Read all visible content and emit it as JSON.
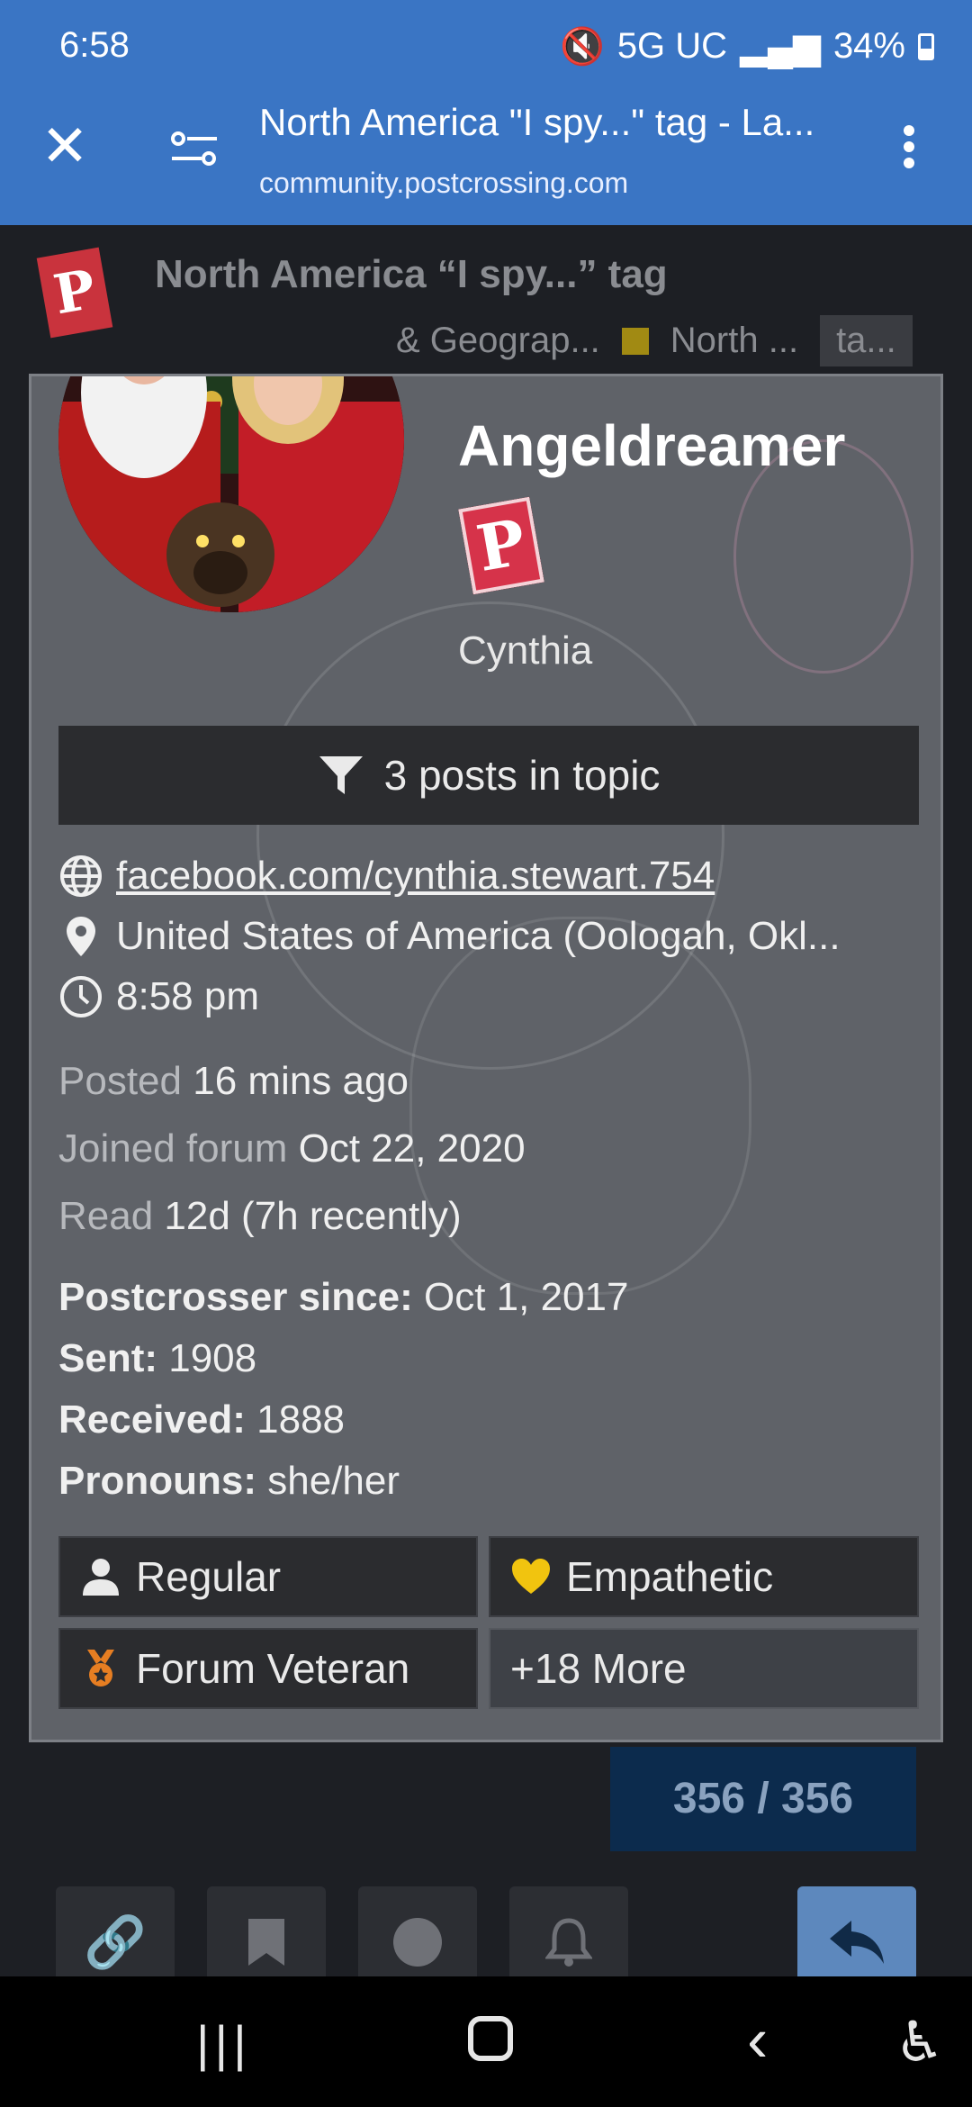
{
  "status_bar": {
    "time": "6:58",
    "network": "5G UC",
    "battery": "34%"
  },
  "browser": {
    "page_title": "North America \"I spy...\" tag - La...",
    "host": "community.postcrossing.com"
  },
  "topic_header": {
    "title": "North America “I spy...” tag",
    "category_parent": "& Geograp...",
    "category": "North ...",
    "tag": "ta..."
  },
  "user_card": {
    "username": "Angeldreamer",
    "badge_letter": "P",
    "name": "Cynthia",
    "filter_button": "3 posts in topic",
    "website": "facebook.com/cynthia.stewart.754",
    "location": "United States of America (Oologah, Okl...",
    "local_time": "8:58 pm",
    "posted_label": "Posted",
    "posted_value": "16 mins ago",
    "joined_label": "Joined forum",
    "joined_value": "Oct 22, 2020",
    "read_label": "Read",
    "read_value": "12d (7h recently)",
    "fields": [
      {
        "label": "Postcrosser since:",
        "value": "Oct 1, 2017"
      },
      {
        "label": "Sent:",
        "value": "1908"
      },
      {
        "label": "Received:",
        "value": "1888"
      },
      {
        "label": "Pronouns:",
        "value": "she/her"
      }
    ],
    "badges": [
      {
        "label": "Regular",
        "icon": "user-icon"
      },
      {
        "label": "Empathetic",
        "icon": "heart-icon"
      },
      {
        "label": "Forum Veteran",
        "icon": "medal-icon"
      },
      {
        "label": "+18 More",
        "icon": ""
      }
    ]
  },
  "timeline": {
    "progress": "356 / 356"
  },
  "colors": {
    "browser_bar": "#3a75c4",
    "card_bg": "#5f6268",
    "badge_heart": "#f1c40f",
    "badge_medal": "#e67e22",
    "reply": "#5d88bd"
  }
}
